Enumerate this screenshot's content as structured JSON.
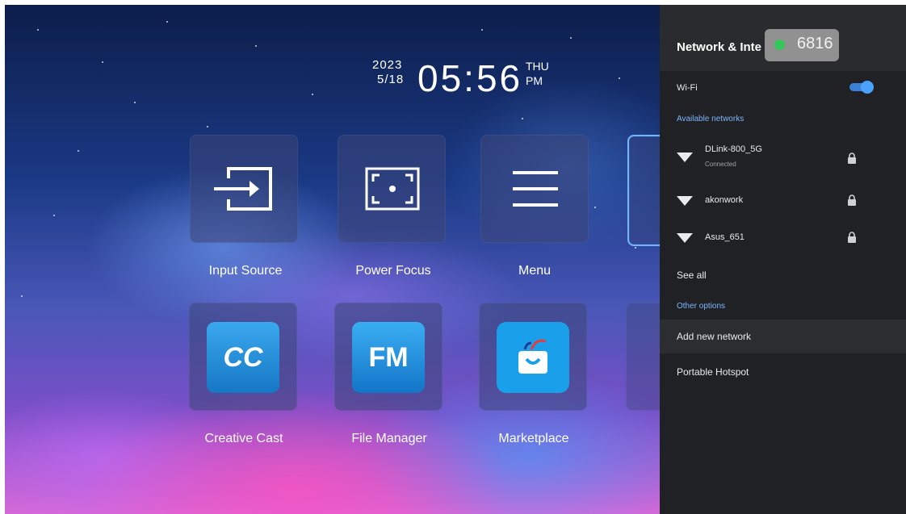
{
  "clock": {
    "year": "2023",
    "month_day": "5/18",
    "time": "05:56",
    "weekday": "THU",
    "ampm": "PM"
  },
  "apps_row1": [
    {
      "label": "Input Source",
      "icon": "input-source-icon"
    },
    {
      "label": "Power Focus",
      "icon": "power-focus-icon"
    },
    {
      "label": "Menu",
      "icon": "menu-icon"
    }
  ],
  "apps_row2": [
    {
      "label": "Creative Cast",
      "icon": "creative-cast-icon",
      "icon_text": "CC",
      "color": "#1f8fd6"
    },
    {
      "label": "File Manager",
      "icon": "file-manager-icon",
      "icon_text": "FM",
      "color": "#1a92dc"
    },
    {
      "label": "Marketplace",
      "icon": "marketplace-icon",
      "color": "#1aa0ea"
    }
  ],
  "network_panel": {
    "title": "Network & Inte",
    "overlay_badge": "6816",
    "wifi_label": "Wi-Fi",
    "wifi_enabled": true,
    "available_heading": "Available networks",
    "networks": [
      {
        "name": "DLink-800_5G",
        "status": "Connected",
        "secured": true
      },
      {
        "name": "akonwork",
        "status": "",
        "secured": true
      },
      {
        "name": "Asus_651",
        "status": "",
        "secured": true
      }
    ],
    "see_all": "See all",
    "other_heading": "Other options",
    "add_network": "Add new network",
    "hotspot": "Portable Hotspot"
  },
  "colors": {
    "accent": "#4aa3ff",
    "panel_bg": "#202124",
    "selected_tile_border": "#6fb8ff"
  }
}
